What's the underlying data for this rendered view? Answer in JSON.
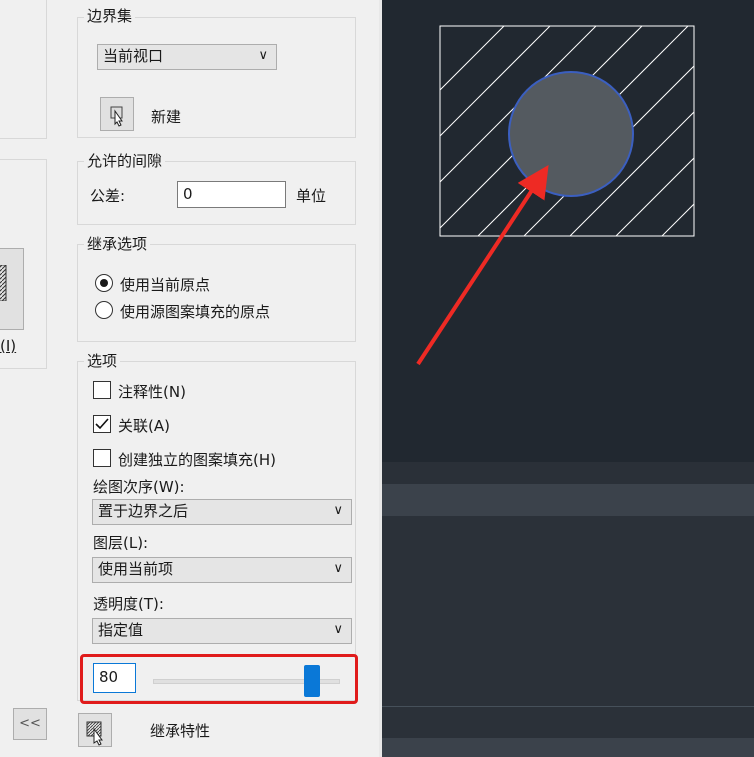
{
  "boundary_set": {
    "title": "边界集",
    "selection_value": "当前视口",
    "new_label": "新建"
  },
  "gap_tolerance": {
    "title": "允许的间隙",
    "tolerance_label": "公差:",
    "tolerance_value": "0",
    "unit_label": "单位"
  },
  "inherit_options": {
    "title": "继承选项",
    "options": [
      "使用当前原点",
      "使用源图案填充的原点"
    ],
    "selected_index": 0
  },
  "options": {
    "title": "选项",
    "annotative_label": "注释性(N)",
    "annotative_checked": false,
    "associative_label": "关联(A)",
    "associative_checked": true,
    "separate_label": "创建独立的图案填充(H)",
    "separate_checked": false,
    "draw_order_label": "绘图次序(W):",
    "draw_order_value": "置于边界之后",
    "layer_label": "图层(L):",
    "layer_value": "使用当前项",
    "transparency_label": "透明度(T):",
    "transparency_value": "指定值",
    "transparency_amount": "80",
    "transparency_slider_fraction": 0.8
  },
  "inherit_properties_label": "继承特性",
  "left_partial_label": "(I)",
  "collapse_label": "<<",
  "colors": {
    "cad_background": "#212830",
    "hatch_lines": "#ffffff",
    "circle_stroke": "#3b5fc0",
    "annotation_arrow": "#ee2a24",
    "highlight_box": "#e01b1b",
    "slider_thumb": "#0a78d7"
  }
}
